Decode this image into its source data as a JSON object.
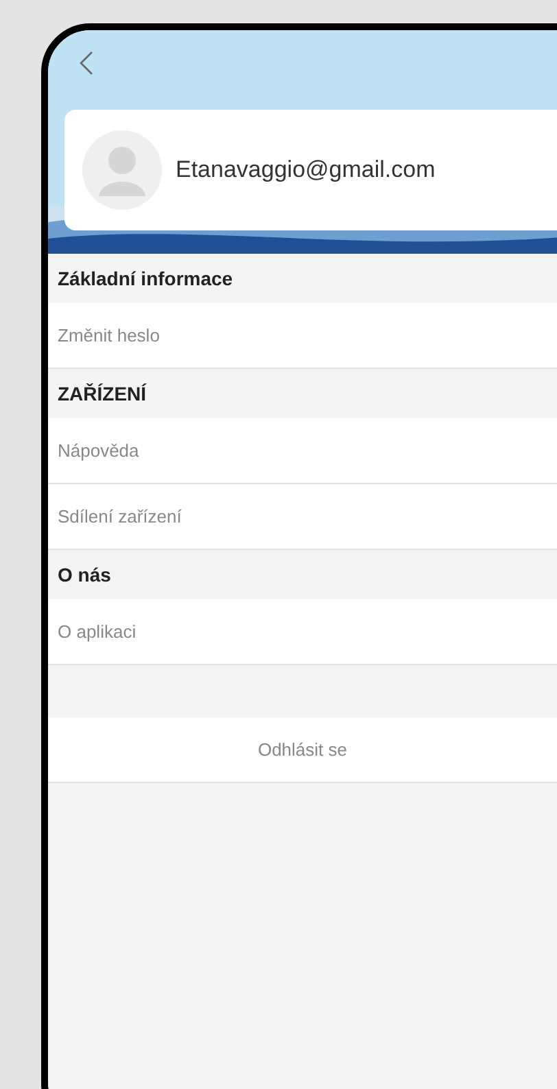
{
  "profile": {
    "email": "Etanavaggio@gmail.com"
  },
  "sections": [
    {
      "title": "Základní informace",
      "items": [
        "Změnit heslo"
      ]
    },
    {
      "title": "ZAŘÍZENÍ",
      "items": [
        "Nápověda",
        "Sdílení zařízení"
      ]
    },
    {
      "title": "O nás",
      "items": [
        "O aplikaci"
      ]
    }
  ],
  "logout": "Odhlásit se"
}
